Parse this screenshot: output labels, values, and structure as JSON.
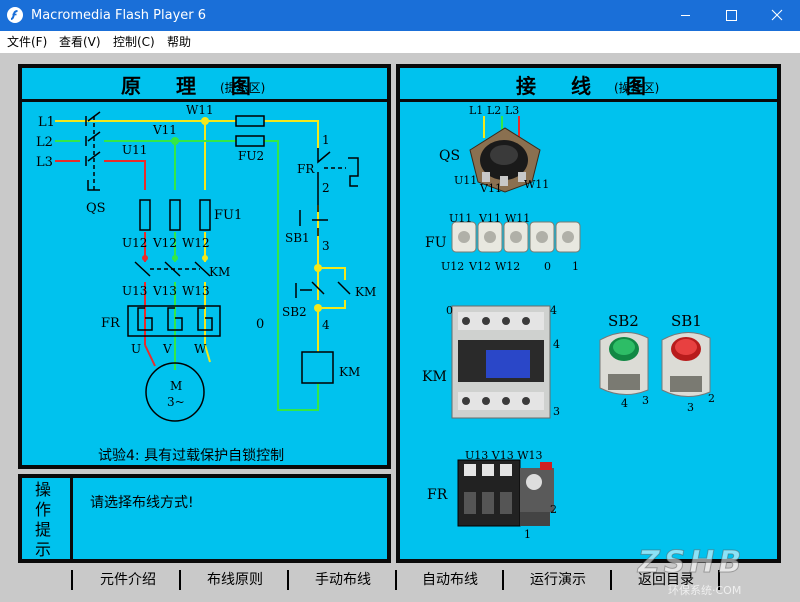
{
  "window": {
    "title": "Macromedia Flash Player 6"
  },
  "menu": [
    "文件(F)",
    "查看(V)",
    "控制(C)",
    "帮助"
  ],
  "left_panel": {
    "title": "原 理 图",
    "subtitle": "(提示区)",
    "caption": "试验4:  具有过载保护自锁控制",
    "labels": {
      "L1": "L1",
      "L2": "L2",
      "L3": "L3",
      "W11": "W11",
      "V11": "V11",
      "U11": "U11",
      "FU2": "FU2",
      "QS": "QS",
      "FU1": "FU1",
      "U12": "U12",
      "V12": "V12",
      "W12": "W12",
      "KM_contact": "KM",
      "U13": "U13",
      "V13": "V13",
      "W13": "W13",
      "FR": "FR",
      "U": "U",
      "V": "V",
      "W": "W",
      "M": "M",
      "M3": "3~",
      "zero": "0",
      "n1": "1",
      "n2": "2",
      "n3": "3",
      "n4": "4",
      "FR_ctrl": "FR",
      "SB1": "SB1",
      "SB2": "SB2",
      "KM_aux": "KM",
      "KM_coil": "KM"
    }
  },
  "right_panel": {
    "title": "接 线 图",
    "subtitle": "(操作区)",
    "labels": {
      "qs_top": [
        "L1",
        "L2",
        "L3"
      ],
      "qs_name": "QS",
      "qs_bottom": [
        "U11",
        "V11",
        "W11"
      ],
      "fu_top": [
        "U11",
        "V11",
        "W11"
      ],
      "fu_name": "FU",
      "fu_bottom": [
        "U12",
        "V12",
        "W12",
        "0",
        "1"
      ],
      "km_name": "KM",
      "km_top_left": "0",
      "km_top_right": "4",
      "km_right_mid": "4",
      "km_right_bottom": "3",
      "sb2_name": "SB2",
      "sb2_terms": [
        "4",
        "3"
      ],
      "sb1_name": "SB1",
      "sb1_terms": [
        "3",
        "2"
      ],
      "fr_top": "U13 V13 W13",
      "fr_name": "FR",
      "fr_right": "2",
      "fr_bottom": "1"
    }
  },
  "prompt": {
    "title": [
      "操",
      "作",
      "提",
      "示"
    ],
    "text": "请选择布线方式!"
  },
  "bottom_nav": [
    "元件介绍",
    "布线原则",
    "手动布线",
    "自动布线",
    "运行演示",
    "返回目录"
  ],
  "watermark": {
    "logo": "ZSHB",
    "sub": "环保系统·COM"
  },
  "colors": {
    "panel_bg": "#00c2ee",
    "frame": "#0a0a0a",
    "stage": "#c9c9c9",
    "title_bar": "#1a6fd8"
  }
}
